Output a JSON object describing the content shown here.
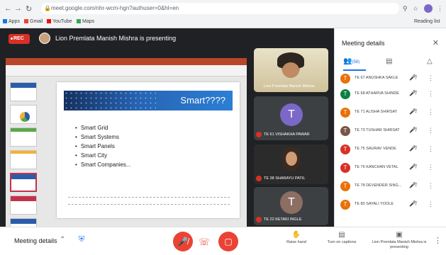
{
  "browser": {
    "url": "meet.google.com/nhr-wcm-hgn?authuser=0&hl=en",
    "bookmarks": [
      "Apps",
      "Gmail",
      "YouTube",
      "Maps"
    ],
    "reading_list": "Reading list"
  },
  "meeting": {
    "rec_label": "REC",
    "presenting_text": "Lion Premlata Manish Mishra is presenting"
  },
  "slide": {
    "title": "Smart????",
    "bullets": [
      "Smart Grid",
      "Smart Systems",
      "Smart Panels",
      "Smart City",
      "Smart Companies..."
    ]
  },
  "tiles": [
    {
      "name": "Lion Premlata Manish Mishra",
      "type": "video"
    },
    {
      "name": "TE 61 VISHAKHA PAWAR",
      "type": "letter",
      "letter": "T",
      "color": "#7b68c8"
    },
    {
      "name": "TE 38 SHARAYU PATIL",
      "type": "video"
    },
    {
      "name": "TE 22 KETAKI INGLE",
      "type": "letter",
      "letter": "T",
      "color": "#8d6e63"
    }
  ],
  "panel": {
    "title": "Meeting details",
    "people_count": "(58)",
    "participants": [
      {
        "name": "TE 67 ANUSHKA SAKLE",
        "letter": "T",
        "color": "#e8710a"
      },
      {
        "name": "TE 68 ATHARVA SHINDE",
        "letter": "T",
        "color": "#0b8043"
      },
      {
        "name": "TE 71 ALISHA SHIRSAT",
        "letter": "T",
        "color": "#e8710a"
      },
      {
        "name": "TE 73 TUSHAR SHIRSAT",
        "letter": "T",
        "color": "#795548"
      },
      {
        "name": "TE 75 SAURAV VENDE",
        "letter": "T",
        "color": "#d93025"
      },
      {
        "name": "TE 76 KANCHAN VETAL",
        "letter": "T",
        "color": "#d93025"
      },
      {
        "name": "TE 78 DEVENDER SING...",
        "letter": "T",
        "color": "#e8710a"
      },
      {
        "name": "TE 80 SAYALI YOOLE",
        "letter": "T",
        "color": "#e8710a"
      }
    ]
  },
  "bottom": {
    "meeting_details": "Meeting details",
    "raise_hand": "Raise hand",
    "captions": "Turn on captions",
    "presenting": "Lion Premlata Manish Mishra is presenting"
  },
  "icons": {
    "mic_off": "mic-off-icon",
    "cam_off": "camera-off-icon",
    "hangup": "hangup-icon",
    "hand": "hand-icon",
    "cc": "captions-icon"
  }
}
